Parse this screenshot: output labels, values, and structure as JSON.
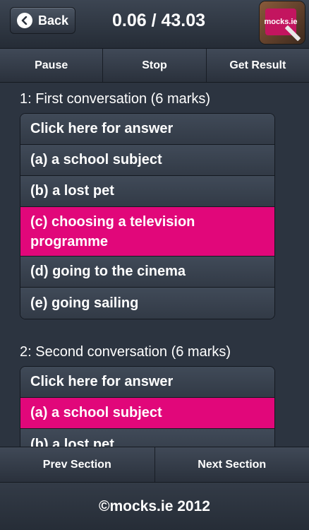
{
  "header": {
    "back_label": "Back",
    "timer": "0.06 / 43.03",
    "logo_text": "mocks.ie"
  },
  "toolbar": {
    "pause": "Pause",
    "stop": "Stop",
    "get_result": "Get Result"
  },
  "questions": [
    {
      "title": "1: First conversation (6 marks)",
      "answer_button": "Click here for answer",
      "options": [
        "(a) a school subject",
        "(b) a lost pet",
        "(c) choosing a television programme",
        "(d) going to the cinema",
        "(e) going sailing"
      ],
      "selected_option": "(c) choosing a television programme"
    },
    {
      "title": "2: Second conversation (6 marks)",
      "answer_button": "Click here for answer",
      "options": [
        "(a) a school subject",
        "(b) a lost pet"
      ],
      "selected_option": "(a) a school subject"
    }
  ],
  "bottom_nav": {
    "prev": "Prev Section",
    "next": "Next Section"
  },
  "footer": {
    "copyright": "©mocks.ie 2012"
  },
  "colors": {
    "selected": "#e1077a",
    "background": "#2c3440"
  }
}
